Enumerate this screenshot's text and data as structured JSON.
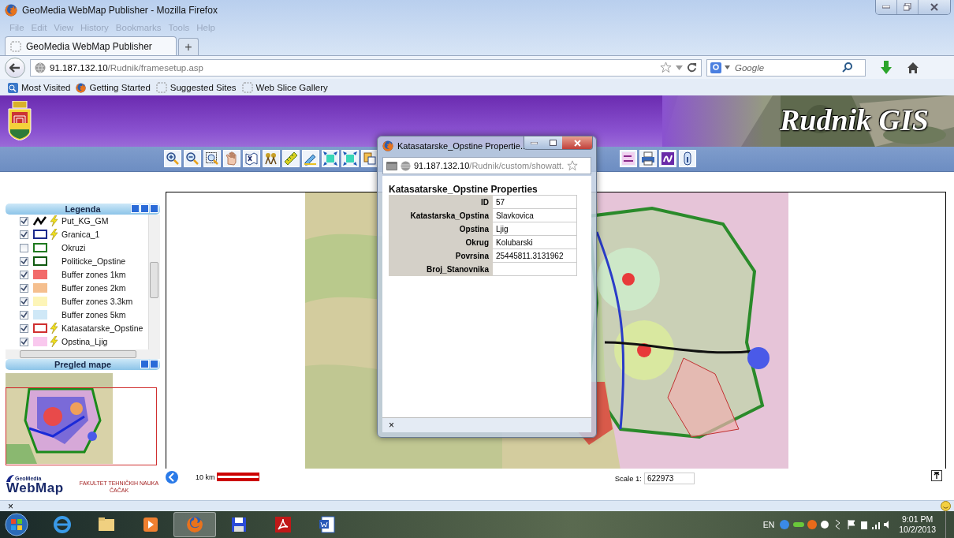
{
  "window": {
    "title": "GeoMedia WebMap Publisher - Mozilla Firefox"
  },
  "menu": [
    "File",
    "Edit",
    "View",
    "History",
    "Bookmarks",
    "Tools",
    "Help"
  ],
  "tabs": [
    {
      "label": "GeoMedia WebMap Publisher",
      "selected": true
    }
  ],
  "new_tab": "+",
  "address": {
    "host": "91.187.132.10",
    "path": "/Rudnik/framesetup.asp"
  },
  "search": {
    "placeholder": "Google"
  },
  "bookmarks": [
    "Most Visited",
    "Getting Started",
    "Suggested Sites",
    "Web Slice Gallery"
  ],
  "header": {
    "title": "Rudnik GIS"
  },
  "legend": {
    "title": "Legenda",
    "layers": [
      {
        "name": "Put_KG_GM",
        "checked": true,
        "kind": "line",
        "color": "#000000",
        "lightning": true
      },
      {
        "name": "Granica_1",
        "checked": true,
        "kind": "outline",
        "color": "#1c2a8c",
        "lightning": true
      },
      {
        "name": "Okruzi",
        "checked": false,
        "kind": "outline",
        "color": "#1f7a1f",
        "lightning": false
      },
      {
        "name": "Politicke_Opstine",
        "checked": true,
        "kind": "outline",
        "color": "#0f5a0f",
        "lightning": false
      },
      {
        "name": "Buffer zones 1km",
        "checked": true,
        "kind": "fill",
        "color": "#f26a6a",
        "lightning": false
      },
      {
        "name": "Buffer zones 2km",
        "checked": true,
        "kind": "fill",
        "color": "#f5bf8e",
        "lightning": false
      },
      {
        "name": "Buffer zones 3.3km",
        "checked": true,
        "kind": "fill",
        "color": "#fdf5b8",
        "lightning": false
      },
      {
        "name": "Buffer zones 5km",
        "checked": true,
        "kind": "fill",
        "color": "#cfe8f7",
        "lightning": false
      },
      {
        "name": "Katasatarske_Opstine",
        "checked": true,
        "kind": "outline",
        "color": "#d03030",
        "lightning": true
      },
      {
        "name": "Opstina_Ljig",
        "checked": true,
        "kind": "fill",
        "color": "#f9c8ee",
        "lightning": true
      }
    ]
  },
  "overview": {
    "title": "Pregled mape"
  },
  "map_footer": {
    "scale_distance": "10 km",
    "scale_label": "Scale 1:",
    "scale_value": "622973"
  },
  "branding": {
    "product_top": "GeoMedia",
    "product": "WebMap",
    "faculty": "FAKULTET TEHNIČKIH NAUKA",
    "city": "ČAČAK"
  },
  "popup": {
    "title": "Katasatarske_Opstine Propertie...",
    "host": "91.187.132.10",
    "path": "/Rudnik/custom/showatt.",
    "heading": "Katasatarske_Opstine Properties",
    "rows": [
      {
        "label": "ID",
        "value": "57"
      },
      {
        "label": "Katastarska_Opstina",
        "value": "Slavkovica"
      },
      {
        "label": "Opstina",
        "value": "Ljig"
      },
      {
        "label": "Okrug",
        "value": "Kolubarski"
      },
      {
        "label": "Povrsina",
        "value": "25445811.3131962"
      },
      {
        "label": "Broj_Stanovnika",
        "value": ""
      }
    ],
    "close": "×"
  },
  "find_bar": {
    "close": "×"
  },
  "taskbar": {
    "language": "EN",
    "time": "9:01 PM",
    "date": "10/2/2013"
  }
}
